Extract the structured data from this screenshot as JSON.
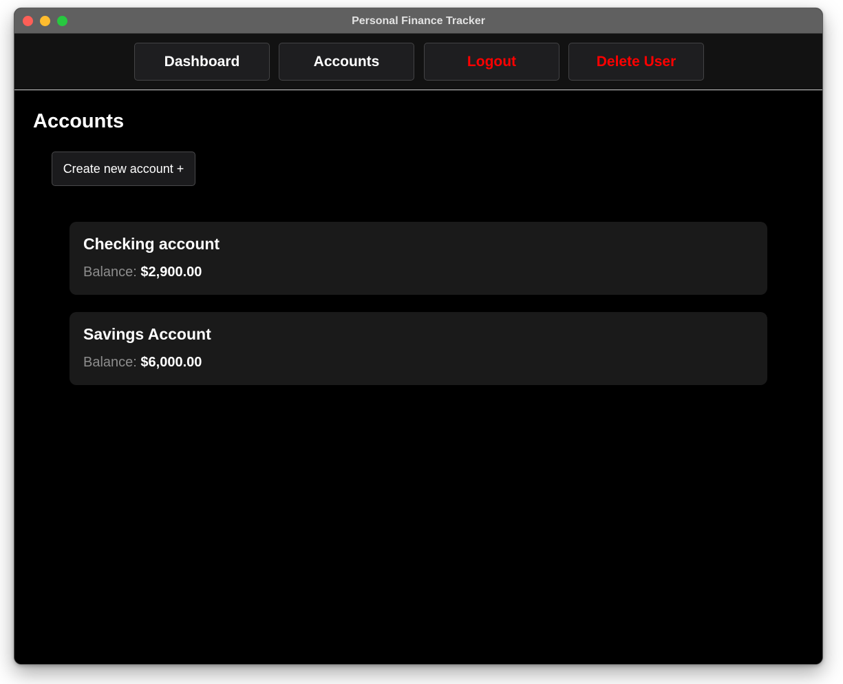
{
  "window": {
    "title": "Personal Finance Tracker",
    "controls": [
      "close",
      "minimize",
      "maximize"
    ]
  },
  "nav": {
    "dashboard": "Dashboard",
    "accounts": "Accounts",
    "logout": "Logout",
    "delete_user": "Delete User"
  },
  "page": {
    "title": "Accounts",
    "create_button": "Create new account +"
  },
  "accounts": [
    {
      "name": "Checking account",
      "balance_label": "Balance:",
      "balance": "$2,900.00"
    },
    {
      "name": "Savings Account",
      "balance_label": "Balance:",
      "balance": "$6,000.00"
    }
  ],
  "colors": {
    "danger": "#ff0000",
    "card": "#1a1a1a",
    "background": "#000000"
  }
}
